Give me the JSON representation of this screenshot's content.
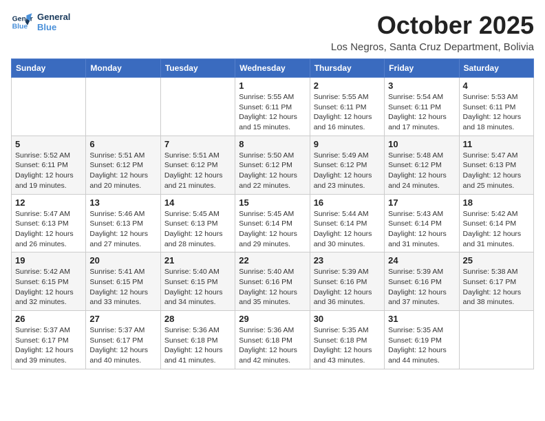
{
  "logo": {
    "line1": "General",
    "line2": "Blue"
  },
  "title": "October 2025",
  "location": "Los Negros, Santa Cruz Department, Bolivia",
  "days_of_week": [
    "Sunday",
    "Monday",
    "Tuesday",
    "Wednesday",
    "Thursday",
    "Friday",
    "Saturday"
  ],
  "weeks": [
    [
      {
        "day": "",
        "info": ""
      },
      {
        "day": "",
        "info": ""
      },
      {
        "day": "",
        "info": ""
      },
      {
        "day": "1",
        "info": "Sunrise: 5:55 AM\nSunset: 6:11 PM\nDaylight: 12 hours and 15 minutes."
      },
      {
        "day": "2",
        "info": "Sunrise: 5:55 AM\nSunset: 6:11 PM\nDaylight: 12 hours and 16 minutes."
      },
      {
        "day": "3",
        "info": "Sunrise: 5:54 AM\nSunset: 6:11 PM\nDaylight: 12 hours and 17 minutes."
      },
      {
        "day": "4",
        "info": "Sunrise: 5:53 AM\nSunset: 6:11 PM\nDaylight: 12 hours and 18 minutes."
      }
    ],
    [
      {
        "day": "5",
        "info": "Sunrise: 5:52 AM\nSunset: 6:11 PM\nDaylight: 12 hours and 19 minutes."
      },
      {
        "day": "6",
        "info": "Sunrise: 5:51 AM\nSunset: 6:12 PM\nDaylight: 12 hours and 20 minutes."
      },
      {
        "day": "7",
        "info": "Sunrise: 5:51 AM\nSunset: 6:12 PM\nDaylight: 12 hours and 21 minutes."
      },
      {
        "day": "8",
        "info": "Sunrise: 5:50 AM\nSunset: 6:12 PM\nDaylight: 12 hours and 22 minutes."
      },
      {
        "day": "9",
        "info": "Sunrise: 5:49 AM\nSunset: 6:12 PM\nDaylight: 12 hours and 23 minutes."
      },
      {
        "day": "10",
        "info": "Sunrise: 5:48 AM\nSunset: 6:12 PM\nDaylight: 12 hours and 24 minutes."
      },
      {
        "day": "11",
        "info": "Sunrise: 5:47 AM\nSunset: 6:13 PM\nDaylight: 12 hours and 25 minutes."
      }
    ],
    [
      {
        "day": "12",
        "info": "Sunrise: 5:47 AM\nSunset: 6:13 PM\nDaylight: 12 hours and 26 minutes."
      },
      {
        "day": "13",
        "info": "Sunrise: 5:46 AM\nSunset: 6:13 PM\nDaylight: 12 hours and 27 minutes."
      },
      {
        "day": "14",
        "info": "Sunrise: 5:45 AM\nSunset: 6:13 PM\nDaylight: 12 hours and 28 minutes."
      },
      {
        "day": "15",
        "info": "Sunrise: 5:45 AM\nSunset: 6:14 PM\nDaylight: 12 hours and 29 minutes."
      },
      {
        "day": "16",
        "info": "Sunrise: 5:44 AM\nSunset: 6:14 PM\nDaylight: 12 hours and 30 minutes."
      },
      {
        "day": "17",
        "info": "Sunrise: 5:43 AM\nSunset: 6:14 PM\nDaylight: 12 hours and 31 minutes."
      },
      {
        "day": "18",
        "info": "Sunrise: 5:42 AM\nSunset: 6:14 PM\nDaylight: 12 hours and 31 minutes."
      }
    ],
    [
      {
        "day": "19",
        "info": "Sunrise: 5:42 AM\nSunset: 6:15 PM\nDaylight: 12 hours and 32 minutes."
      },
      {
        "day": "20",
        "info": "Sunrise: 5:41 AM\nSunset: 6:15 PM\nDaylight: 12 hours and 33 minutes."
      },
      {
        "day": "21",
        "info": "Sunrise: 5:40 AM\nSunset: 6:15 PM\nDaylight: 12 hours and 34 minutes."
      },
      {
        "day": "22",
        "info": "Sunrise: 5:40 AM\nSunset: 6:16 PM\nDaylight: 12 hours and 35 minutes."
      },
      {
        "day": "23",
        "info": "Sunrise: 5:39 AM\nSunset: 6:16 PM\nDaylight: 12 hours and 36 minutes."
      },
      {
        "day": "24",
        "info": "Sunrise: 5:39 AM\nSunset: 6:16 PM\nDaylight: 12 hours and 37 minutes."
      },
      {
        "day": "25",
        "info": "Sunrise: 5:38 AM\nSunset: 6:17 PM\nDaylight: 12 hours and 38 minutes."
      }
    ],
    [
      {
        "day": "26",
        "info": "Sunrise: 5:37 AM\nSunset: 6:17 PM\nDaylight: 12 hours and 39 minutes."
      },
      {
        "day": "27",
        "info": "Sunrise: 5:37 AM\nSunset: 6:17 PM\nDaylight: 12 hours and 40 minutes."
      },
      {
        "day": "28",
        "info": "Sunrise: 5:36 AM\nSunset: 6:18 PM\nDaylight: 12 hours and 41 minutes."
      },
      {
        "day": "29",
        "info": "Sunrise: 5:36 AM\nSunset: 6:18 PM\nDaylight: 12 hours and 42 minutes."
      },
      {
        "day": "30",
        "info": "Sunrise: 5:35 AM\nSunset: 6:18 PM\nDaylight: 12 hours and 43 minutes."
      },
      {
        "day": "31",
        "info": "Sunrise: 5:35 AM\nSunset: 6:19 PM\nDaylight: 12 hours and 44 minutes."
      },
      {
        "day": "",
        "info": ""
      }
    ]
  ]
}
